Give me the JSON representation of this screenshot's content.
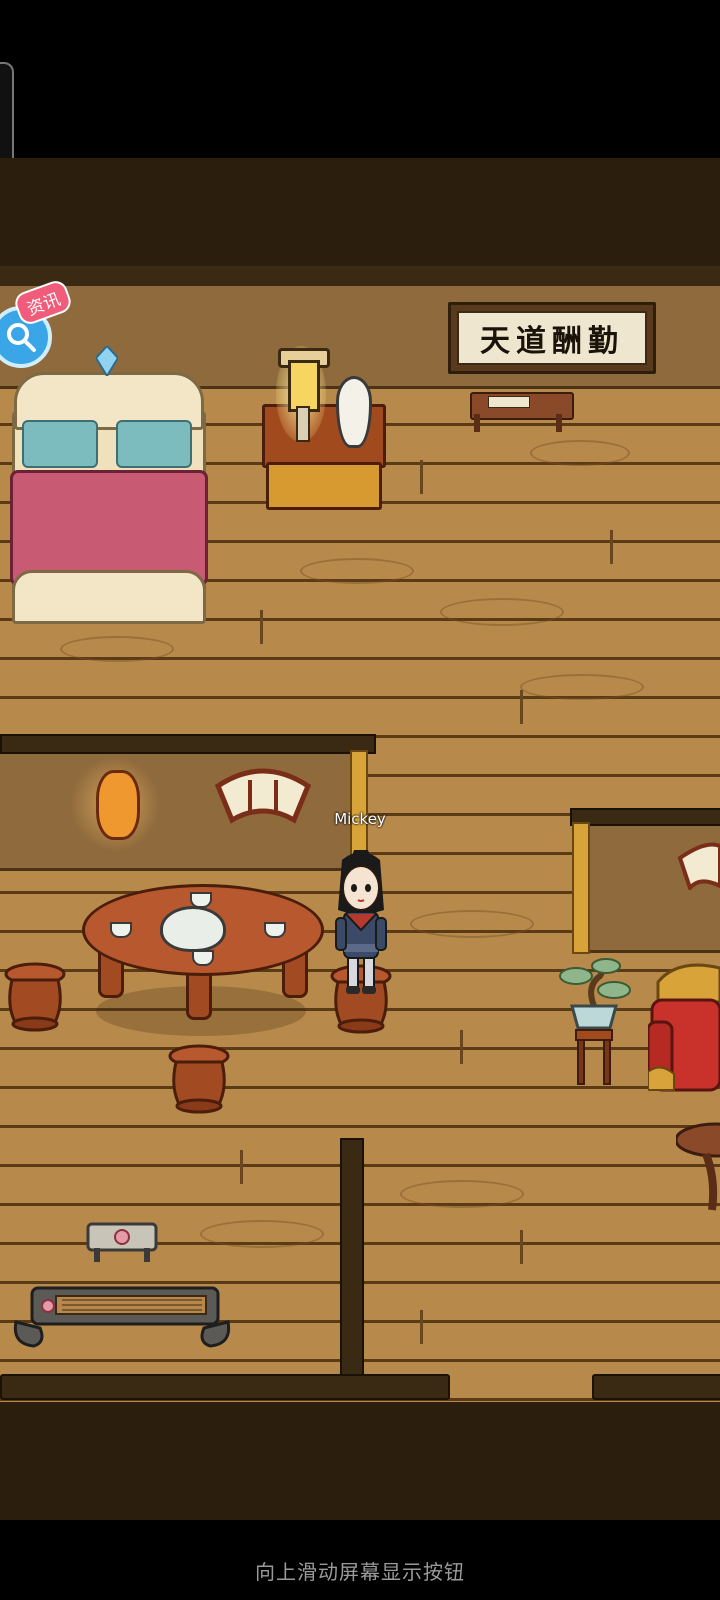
{
  "game": {
    "plaque_text": "天道酬勤",
    "player_name": "Mickey",
    "news_button_label": "资讯"
  },
  "system": {
    "gesture_hint": "向上滑动屏幕显示按钮"
  },
  "colors": {
    "floor": "#b78a4c",
    "wall": "#8f6a3c",
    "beam": "#3a2a14",
    "bed_blanket": "#c85a74",
    "pillow": "#7cbcbf",
    "news_button": "#3aa6e8",
    "news_badge": "#f05c7a"
  },
  "icons": {
    "news": "magnifier-icon"
  }
}
